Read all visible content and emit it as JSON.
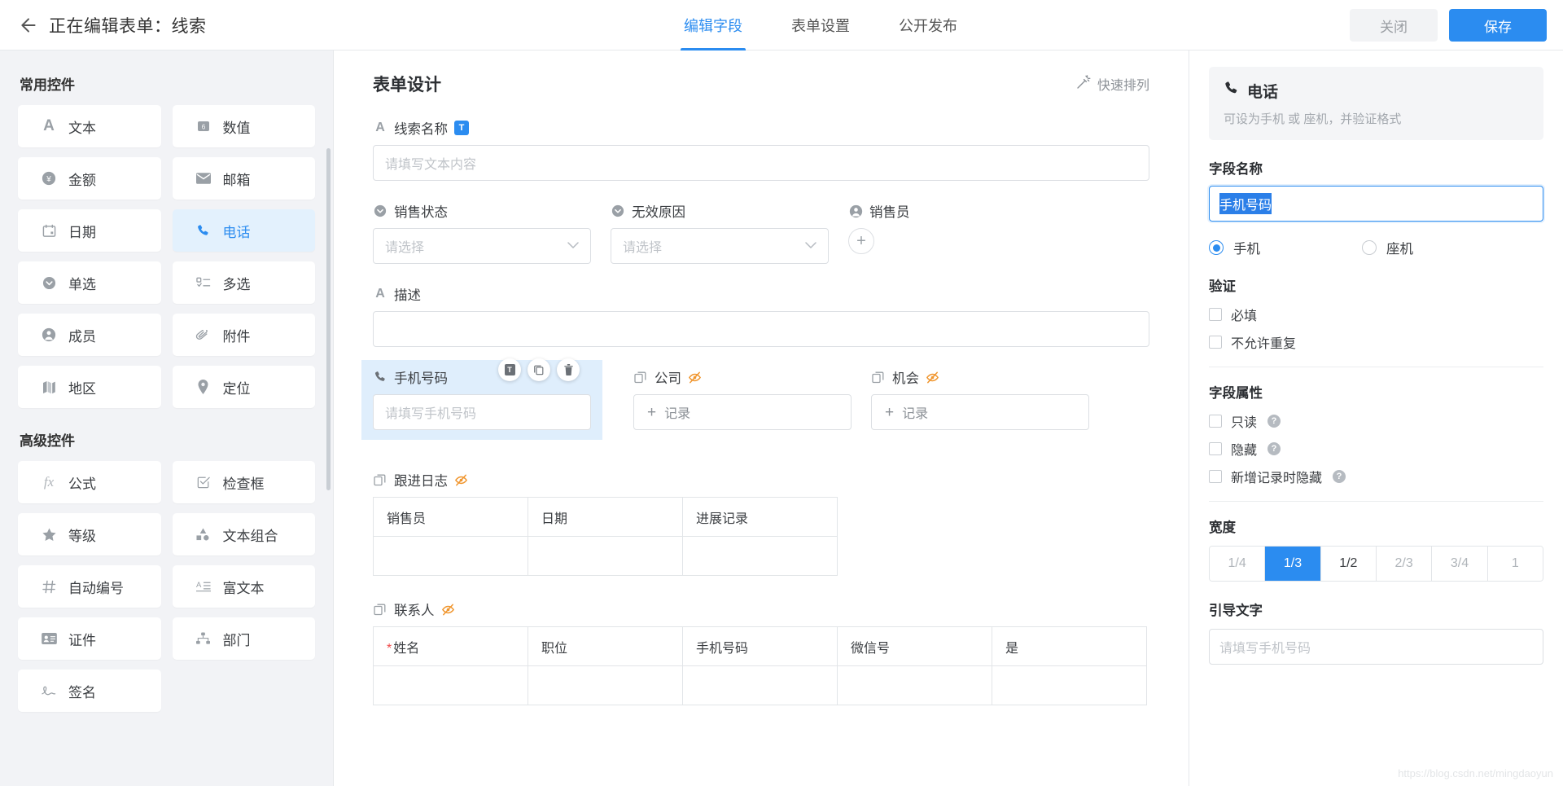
{
  "topbar": {
    "back_icon": "arrow-left-icon",
    "title": "正在编辑表单：线索",
    "tabs": [
      {
        "label": "编辑字段",
        "active": true
      },
      {
        "label": "表单设置",
        "active": false
      },
      {
        "label": "公开发布",
        "active": false
      }
    ],
    "close_label": "关闭",
    "save_label": "保存"
  },
  "palette": {
    "section_common": "常用控件",
    "section_advanced": "高级控件",
    "common_items": [
      {
        "label": "文本",
        "icon": "letter-a-icon",
        "selected": false
      },
      {
        "label": "数值",
        "icon": "number-icon",
        "selected": false
      },
      {
        "label": "金额",
        "icon": "yuan-icon",
        "selected": false
      },
      {
        "label": "邮箱",
        "icon": "envelope-icon",
        "selected": false
      },
      {
        "label": "日期",
        "icon": "calendar-icon",
        "selected": false
      },
      {
        "label": "电话",
        "icon": "phone-icon",
        "selected": true
      },
      {
        "label": "单选",
        "icon": "radio-dropdown-icon",
        "selected": false
      },
      {
        "label": "多选",
        "icon": "checklist-icon",
        "selected": false
      },
      {
        "label": "成员",
        "icon": "user-icon",
        "selected": false
      },
      {
        "label": "附件",
        "icon": "paperclip-icon",
        "selected": false
      },
      {
        "label": "地区",
        "icon": "map-icon",
        "selected": false
      },
      {
        "label": "定位",
        "icon": "location-pin-icon",
        "selected": false
      }
    ],
    "advanced_items": [
      {
        "label": "公式",
        "icon": "fx-icon"
      },
      {
        "label": "检查框",
        "icon": "checkbox-icon"
      },
      {
        "label": "等级",
        "icon": "star-icon"
      },
      {
        "label": "文本组合",
        "icon": "shapes-icon"
      },
      {
        "label": "自动编号",
        "icon": "hash-icon"
      },
      {
        "label": "富文本",
        "icon": "rich-text-icon"
      },
      {
        "label": "证件",
        "icon": "id-card-icon"
      },
      {
        "label": "部门",
        "icon": "org-chart-icon"
      },
      {
        "label": "签名",
        "icon": "signature-icon"
      }
    ]
  },
  "canvas": {
    "title": "表单设计",
    "quick_arrange": "快速排列",
    "field_lead_name": {
      "label": "线索名称",
      "badge": "T",
      "placeholder": "请填写文本内容",
      "icon": "letter-a-icon"
    },
    "field_sales_status": {
      "label": "销售状态",
      "placeholder": "请选择",
      "icon": "radio-dropdown-icon"
    },
    "field_invalid_reason": {
      "label": "无效原因",
      "placeholder": "请选择",
      "icon": "radio-dropdown-icon"
    },
    "field_salesperson": {
      "label": "销售员",
      "icon": "user-icon",
      "add_label": "+"
    },
    "field_description": {
      "label": "描述",
      "placeholder": "",
      "icon": "letter-a-icon"
    },
    "field_phone": {
      "label": "手机号码",
      "placeholder": "请填写手机号码",
      "icon": "phone-icon"
    },
    "field_company": {
      "label": "公司",
      "record_label": "记录",
      "icon": "relation-icon",
      "hidden_icon": "eye-off-icon"
    },
    "field_opportunity": {
      "label": "机会",
      "record_label": "记录",
      "icon": "relation-icon",
      "hidden_icon": "eye-off-icon"
    },
    "tools": [
      {
        "name": "text-tool",
        "glyph": "T"
      },
      {
        "name": "copy-tool",
        "glyph": "copy"
      },
      {
        "name": "delete-tool",
        "glyph": "trash"
      }
    ],
    "table_follow_log": {
      "label": "跟进日志",
      "icon": "relation-icon",
      "hidden_icon": "eye-off-icon",
      "columns": [
        "销售员",
        "日期",
        "进展记录"
      ],
      "rows": [
        [
          "",
          "",
          ""
        ]
      ]
    },
    "table_contact": {
      "label": "联系人",
      "icon": "relation-icon",
      "hidden_icon": "eye-off-icon",
      "columns": [
        "姓名",
        "职位",
        "手机号码",
        "微信号",
        "是"
      ],
      "required_first": true,
      "rows": [
        [
          "",
          "",
          "",
          "",
          ""
        ]
      ]
    }
  },
  "props": {
    "card_title": "电话",
    "card_icon": "phone-icon",
    "card_desc": "可设为手机 或 座机，并验证格式",
    "field_name_label": "字段名称",
    "field_name_value": "手机号码",
    "type_options": [
      {
        "label": "手机",
        "selected": true
      },
      {
        "label": "座机",
        "selected": false
      }
    ],
    "validate_title": "验证",
    "validate_items": [
      {
        "label": "必填",
        "checked": false,
        "help": false
      },
      {
        "label": "不允许重复",
        "checked": false,
        "help": false
      }
    ],
    "attr_title": "字段属性",
    "attr_items": [
      {
        "label": "只读",
        "checked": false,
        "help": true
      },
      {
        "label": "隐藏",
        "checked": false,
        "help": true
      },
      {
        "label": "新增记录时隐藏",
        "checked": false,
        "help": true
      }
    ],
    "width_title": "宽度",
    "width_options": [
      {
        "label": "1/4",
        "active": false,
        "dark": false
      },
      {
        "label": "1/3",
        "active": true,
        "dark": false
      },
      {
        "label": "1/2",
        "active": false,
        "dark": true
      },
      {
        "label": "2/3",
        "active": false,
        "dark": false
      },
      {
        "label": "3/4",
        "active": false,
        "dark": false
      },
      {
        "label": "1",
        "active": false,
        "dark": false
      }
    ],
    "guide_title": "引导文字",
    "guide_placeholder": "请填写手机号码",
    "help_glyph": "?"
  },
  "watermark": "https://blog.csdn.net/mingdaoyun"
}
